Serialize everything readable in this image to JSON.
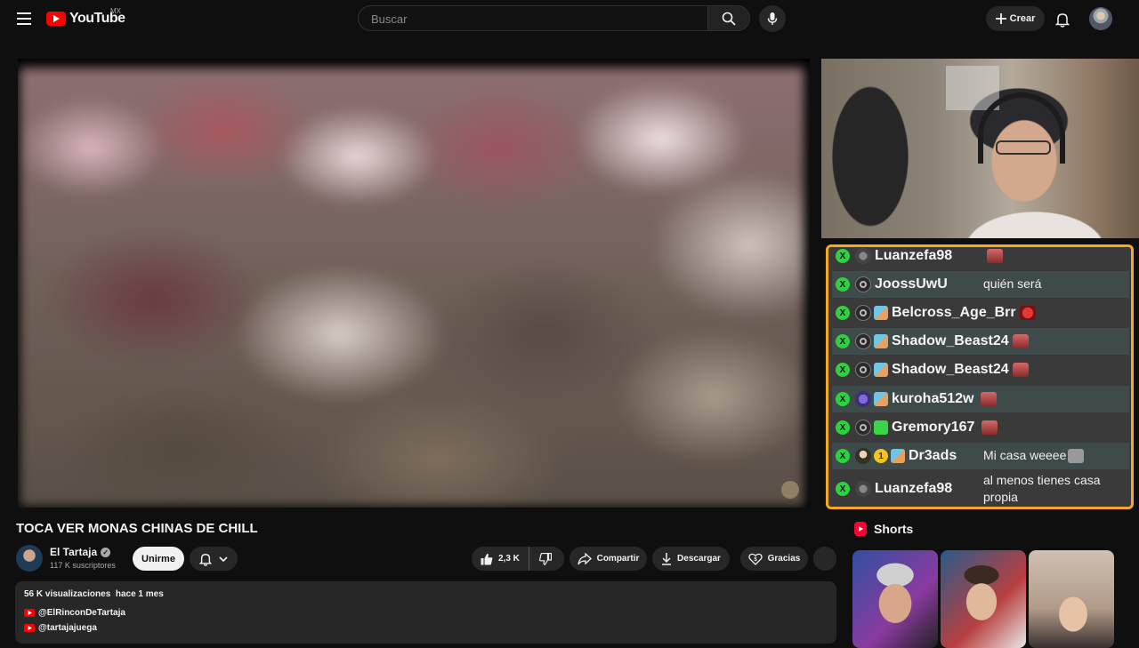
{
  "header": {
    "logo_text": "YouTube",
    "region": "MX",
    "search_placeholder": "Buscar",
    "create_label": "Crear"
  },
  "chat": {
    "messages": [
      {
        "user": "Luanzefa98",
        "text": ""
      },
      {
        "user": "JoossUwU",
        "text": "quién será"
      },
      {
        "user": "Belcross_Age_Brr",
        "text": ""
      },
      {
        "user": "Shadow_Beast24",
        "text": ""
      },
      {
        "user": "Shadow_Beast24",
        "text": ""
      },
      {
        "user": "kuroha512w",
        "text": ""
      },
      {
        "user": "Gremory167",
        "text": ""
      },
      {
        "user": "Dr3ads",
        "badge": "1",
        "text": "Mi casa weeee"
      },
      {
        "user": "Luanzefa98",
        "text": "al menos tienes casa propia"
      }
    ]
  },
  "video": {
    "title": "TOCA VER MONAS CHINAS DE CHILL",
    "channel": "El Tartaja",
    "subscribers": "117 K suscriptores",
    "join_label": "Unirme",
    "likes": "2,3 K",
    "share_label": "Compartir",
    "download_label": "Descargar",
    "thanks_label": "Gracias"
  },
  "description": {
    "views": "56 K visualizaciones",
    "date": "hace 1 mes",
    "links": [
      "@ElRinconDeTartaja",
      "@tartajajuega"
    ]
  },
  "sidebar": {
    "shorts_title": "Shorts"
  },
  "colors": {
    "background": "#0f0f0f",
    "brand_red": "#ff0000",
    "chat_border": "#f4a824",
    "xbox_green": "#2bd43c"
  }
}
